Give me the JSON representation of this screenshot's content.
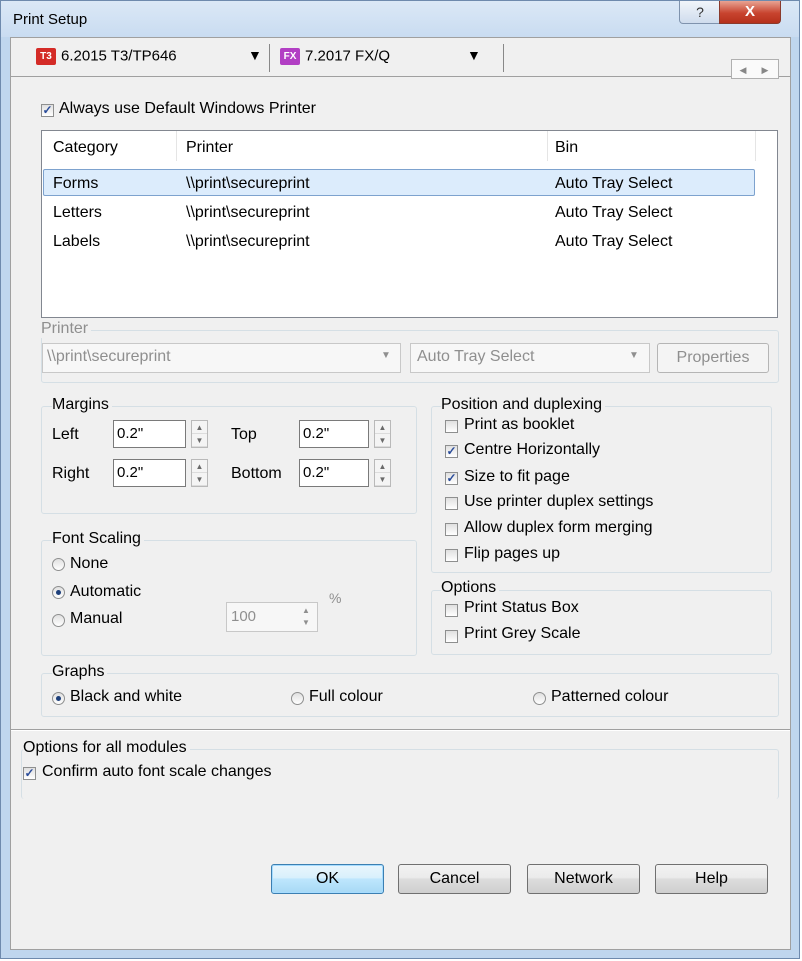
{
  "window": {
    "title": "Print Setup",
    "help_glyph": "?",
    "close_glyph": "X"
  },
  "tabs": [
    {
      "icon_text": "T3",
      "icon_color": "#d42b27",
      "label": "6.2015 T3/TP646",
      "dropdown": "▼"
    },
    {
      "icon_text": "FX",
      "icon_color": "#b23fc4",
      "label": "7.2017 FX/Q",
      "dropdown": "▼"
    }
  ],
  "tab_scroll": {
    "left": "◀",
    "right": "▶"
  },
  "default_printer": {
    "label": "Always use Default Windows Printer",
    "checked": true
  },
  "list": {
    "headers": [
      "Category",
      "Printer",
      "Bin"
    ],
    "rows": [
      {
        "category": "Forms",
        "printer": "\\\\print\\secureprint",
        "bin": "Auto Tray Select",
        "selected": true
      },
      {
        "category": "Letters",
        "printer": "\\\\print\\secureprint",
        "bin": "Auto Tray Select"
      },
      {
        "category": "Labels",
        "printer": "\\\\print\\secureprint",
        "bin": "Auto Tray Select"
      }
    ]
  },
  "printer_group": {
    "label": "Printer",
    "printer_value": "\\\\print\\secureprint",
    "bin_value": "Auto Tray Select",
    "properties_label": "Properties"
  },
  "margins": {
    "label": "Margins",
    "left_label": "Left",
    "left_value": "0.2\"",
    "top_label": "Top",
    "top_value": "0.2\"",
    "right_label": "Right",
    "right_value": "0.2\"",
    "bottom_label": "Bottom",
    "bottom_value": "0.2\""
  },
  "font_scaling": {
    "label": "Font Scaling",
    "none": "None",
    "automatic": "Automatic",
    "manual": "Manual",
    "selected": "Automatic",
    "manual_value": "100",
    "percent": "%"
  },
  "position": {
    "label": "Position and duplexing",
    "items": [
      {
        "label": "Print as booklet",
        "checked": false
      },
      {
        "label": "Centre Horizontally",
        "checked": true
      },
      {
        "label": "Size to fit page",
        "checked": true
      },
      {
        "label": "Use printer duplex settings",
        "checked": false
      },
      {
        "label": "Allow duplex form merging",
        "checked": false
      },
      {
        "label": "Flip pages up",
        "checked": false
      }
    ]
  },
  "options": {
    "label": "Options",
    "items": [
      {
        "label": "Print Status Box",
        "checked": false
      },
      {
        "label": "Print Grey Scale",
        "checked": false
      }
    ]
  },
  "graphs": {
    "label": "Graphs",
    "black_white": "Black and white",
    "full_colour": "Full colour",
    "patterned": "Patterned colour",
    "selected": "Black and white"
  },
  "all_modules": {
    "label": "Options for all modules",
    "confirm_label": "Confirm auto font scale changes",
    "confirm_checked": true
  },
  "buttons": {
    "ok": "OK",
    "cancel": "Cancel",
    "network": "Network",
    "help": "Help"
  },
  "colors": {
    "selection": "#cde8ff",
    "accent": "#3399ff"
  }
}
